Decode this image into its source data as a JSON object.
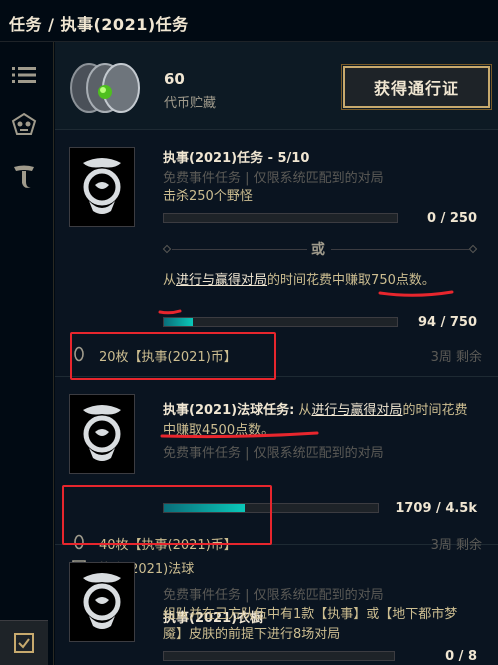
{
  "header": {
    "title": "任务 / 执事(2021)任务"
  },
  "currency": {
    "amount": "60",
    "label": "代币贮藏",
    "button": "获得通行证"
  },
  "missions": [
    {
      "title": "执事(2021)任务 - 5/10",
      "subtitle": "免费事件任务 | 仅限系统匹配到的对局",
      "objective1": "击杀250个野怪",
      "count1": "0 / 250",
      "or_label": "或",
      "obj2_pre": "从",
      "obj2_link": "进行与赢得对局",
      "obj2_mid": "的时间花费中",
      "obj2_post": "赚取750点数。",
      "count2": "94 / 750",
      "reward": "20枚【执事(2021)币】",
      "time": "3周 剩余"
    },
    {
      "title_bold": "执事(2021)法球任务:",
      "title_pre": "从",
      "title_link": "进行与赢得对局",
      "title_mid": "的时间花费中",
      "title_post": "赚取4500点数。",
      "subtitle": "免费事件任务 | 仅限系统匹配到的对局",
      "count": "1709 / 4.5k",
      "reward1": "40枚【执事(2021)币】",
      "reward2": "执事(2021)法球",
      "time": "3周 剩余"
    },
    {
      "title": "执事(2021)衣橱",
      "subtitle": "免费事件任务 | 仅限系统匹配到的对局",
      "objective": "组队并在己方队伍中有1款【执事】或【地下都市梦魇】皮肤的前提下进行8场对局",
      "count": "0 / 8"
    }
  ],
  "progress": {
    "m1_bar1": 0,
    "m1_bar2": 0.125,
    "m2_bar": 0.38,
    "m3_bar": 0
  },
  "colors": {
    "gold": "#c8aa6e",
    "teal": "#0ac8b9",
    "annotation_red": "#e8262d"
  },
  "icons": [
    "list-icon",
    "ward-skull-icon",
    "tft-icon",
    "checklist-icon",
    "crest-icon",
    "token-icon",
    "orb-icon"
  ]
}
